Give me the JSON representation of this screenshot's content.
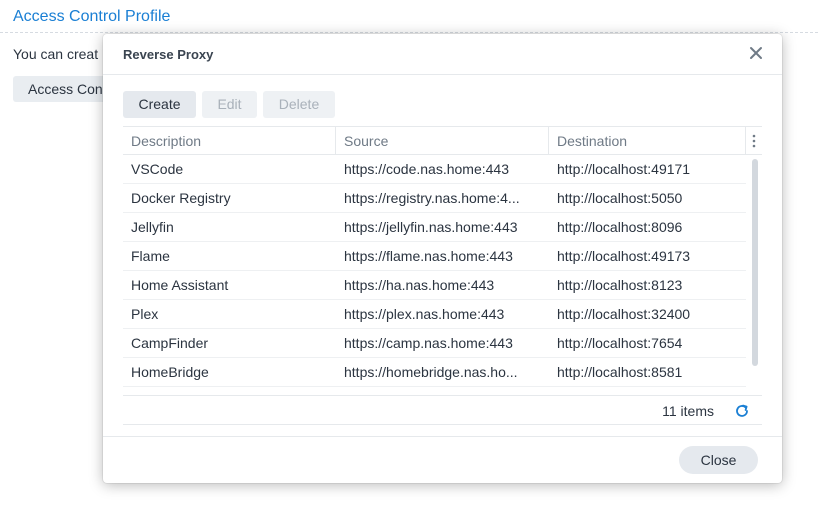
{
  "background": {
    "title": "Access Control Profile",
    "description": "You can creat",
    "button_label": "Access Con"
  },
  "dialog": {
    "title": "Reverse Proxy",
    "toolbar": {
      "create_label": "Create",
      "edit_label": "Edit",
      "delete_label": "Delete"
    },
    "table": {
      "columns": [
        "Description",
        "Source",
        "Destination"
      ],
      "rows": [
        {
          "description": "VSCode",
          "source": "https://code.nas.home:443",
          "destination": "http://localhost:49171"
        },
        {
          "description": "Docker Registry",
          "source": "https://registry.nas.home:4...",
          "destination": "http://localhost:5050"
        },
        {
          "description": "Jellyfin",
          "source": "https://jellyfin.nas.home:443",
          "destination": "http://localhost:8096"
        },
        {
          "description": "Flame",
          "source": "https://flame.nas.home:443",
          "destination": "http://localhost:49173"
        },
        {
          "description": "Home Assistant",
          "source": "https://ha.nas.home:443",
          "destination": "http://localhost:8123"
        },
        {
          "description": "Plex",
          "source": "https://plex.nas.home:443",
          "destination": "http://localhost:32400"
        },
        {
          "description": "CampFinder",
          "source": "https://camp.nas.home:443",
          "destination": "http://localhost:7654"
        },
        {
          "description": "HomeBridge",
          "source": "https://homebridge.nas.ho...",
          "destination": "http://localhost:8581"
        }
      ]
    },
    "footer": {
      "item_count": "11 items",
      "close_label": "Close"
    }
  },
  "icons": {
    "close": "close-icon",
    "column_menu": "vertical-ellipsis-icon",
    "refresh": "refresh-icon"
  },
  "colors": {
    "accent": "#1a7fd4",
    "button_bg": "#e5e9ee",
    "disabled_text": "#a9b1ba"
  }
}
